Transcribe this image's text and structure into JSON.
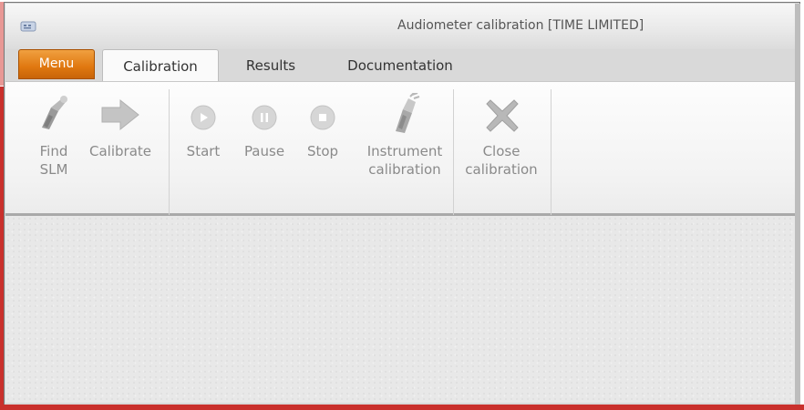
{
  "window": {
    "title": "Audiometer calibration [TIME LIMITED]",
    "app_icon": "audiometer-app-icon"
  },
  "tabs": {
    "menu_label": "Menu",
    "items": [
      {
        "label": "Calibration",
        "active": true
      },
      {
        "label": "Results",
        "active": false
      },
      {
        "label": "Documentation",
        "active": false
      }
    ]
  },
  "ribbon": {
    "buttons": [
      {
        "label_line1": "Find",
        "label_line2": "SLM",
        "icon": "sound-level-meter-icon",
        "enabled": false
      },
      {
        "label_line1": "Calibrate",
        "label_line2": "",
        "icon": "arrow-right-icon",
        "enabled": false
      },
      {
        "label_line1": "Start",
        "label_line2": "",
        "icon": "play-icon",
        "enabled": false
      },
      {
        "label_line1": "Pause",
        "label_line2": "",
        "icon": "pause-icon",
        "enabled": false
      },
      {
        "label_line1": "Stop",
        "label_line2": "",
        "icon": "stop-icon",
        "enabled": false
      },
      {
        "label_line1": "Instrument",
        "label_line2": "calibration",
        "icon": "calibrator-icon",
        "enabled": false
      },
      {
        "label_line1": "Close",
        "label_line2": "calibration",
        "icon": "close-x-icon",
        "enabled": false
      }
    ]
  },
  "colors": {
    "menu_orange": "#e07810",
    "disabled_text": "#8a8a8a",
    "frame_red": "#c9302c"
  }
}
